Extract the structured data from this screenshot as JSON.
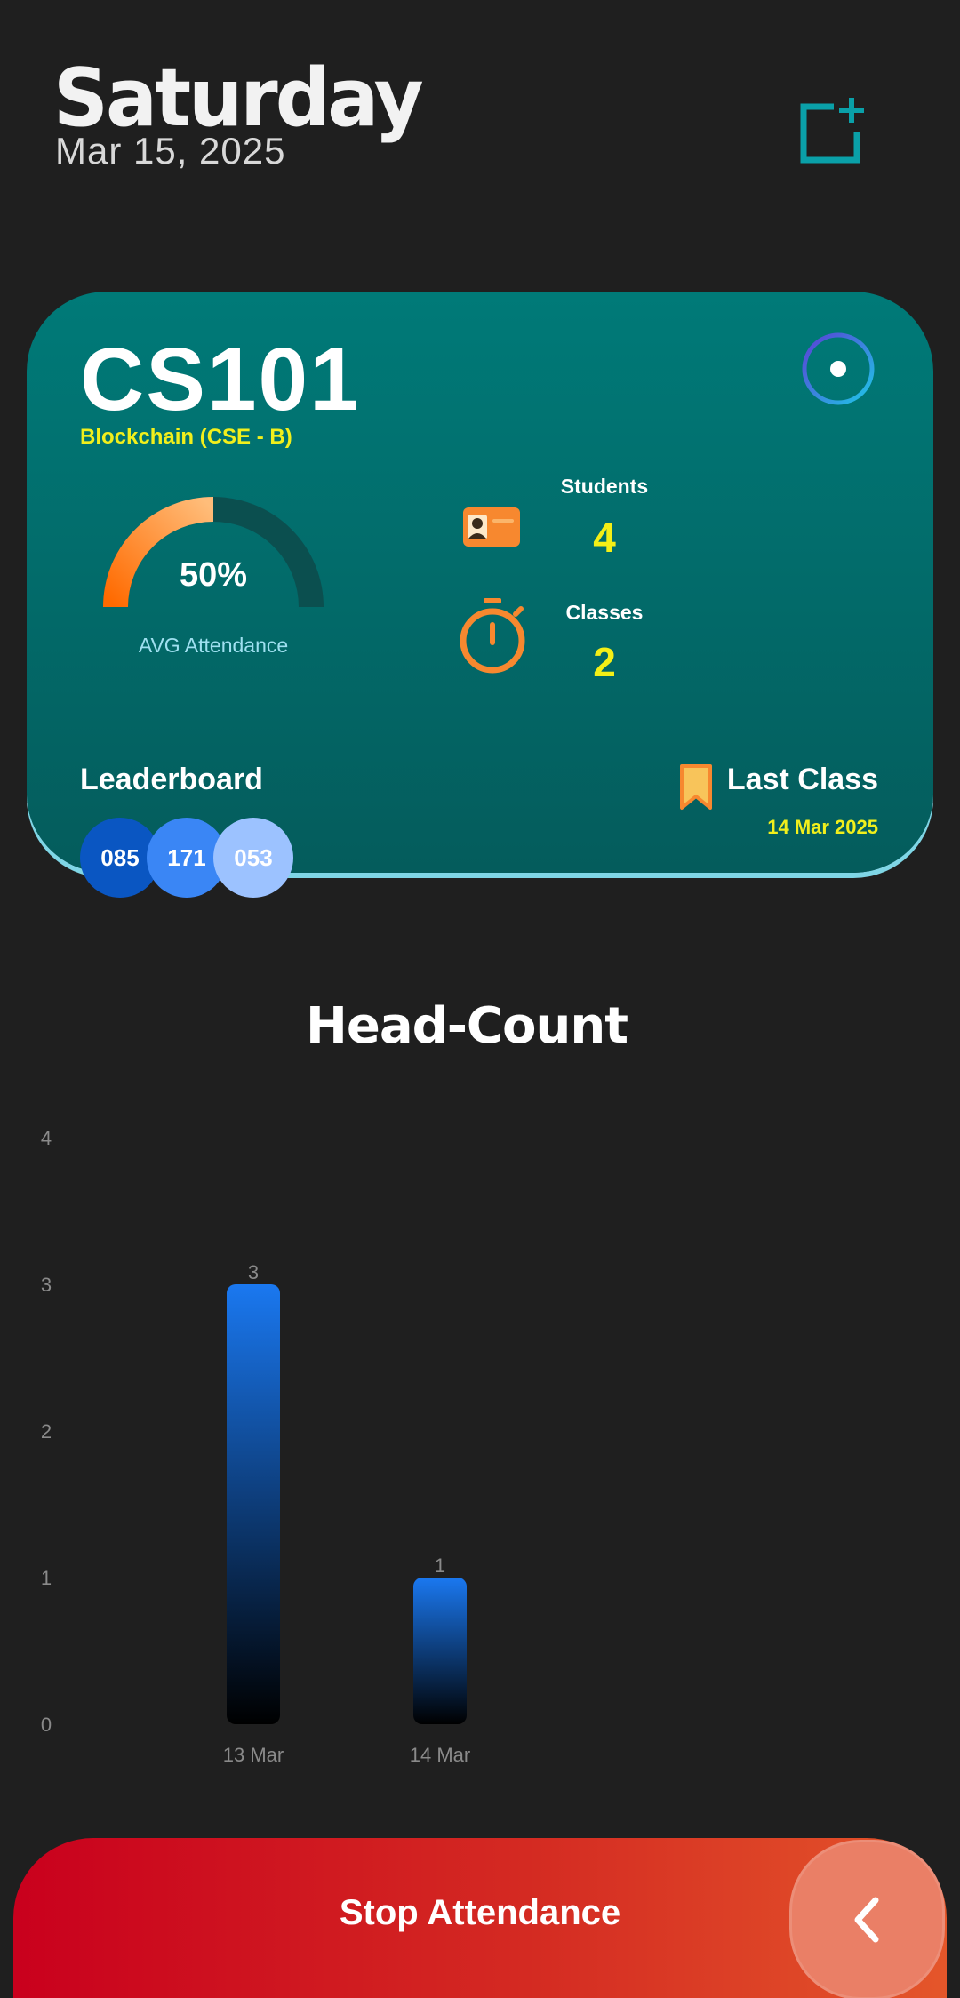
{
  "header": {
    "day": "Saturday",
    "date": "Mar 15, 2025",
    "add_icon": "add-square-icon"
  },
  "card": {
    "course_code": "CS101",
    "course_name": "Blockchain (CSE - B)",
    "avg_attendance_value": "50%",
    "avg_attendance_percent": 50,
    "avg_attendance_label": "AVG Attendance",
    "students_label": "Students",
    "students_value": "4",
    "classes_label": "Classes",
    "classes_value": "2",
    "leaderboard_title": "Leaderboard",
    "leaderboard": [
      "085",
      "171",
      "053"
    ],
    "last_class_label": "Last Class",
    "last_class_date": "14 Mar 2025"
  },
  "chart_title": "Head-Count",
  "chart_data": {
    "type": "bar",
    "categories": [
      "13 Mar",
      "14 Mar"
    ],
    "values": [
      3,
      1
    ],
    "data_labels": [
      "3",
      "1"
    ],
    "ylim": [
      0,
      4
    ],
    "yticks": [
      "0",
      "1",
      "2",
      "3",
      "4"
    ],
    "grid": false,
    "colors": {
      "top": "#1a78f0",
      "bottom": "#000000"
    }
  },
  "footer": {
    "stop_label": "Stop Attendance",
    "back_icon": "chevron-left-icon"
  },
  "colors": {
    "background": "#1f1f1f",
    "card_top": "#007a78",
    "card_bottom": "#045c5c",
    "accent_yellow": "#f1ef1c",
    "accent_orange": "#f7882f",
    "stop_red": "#c9001d"
  }
}
